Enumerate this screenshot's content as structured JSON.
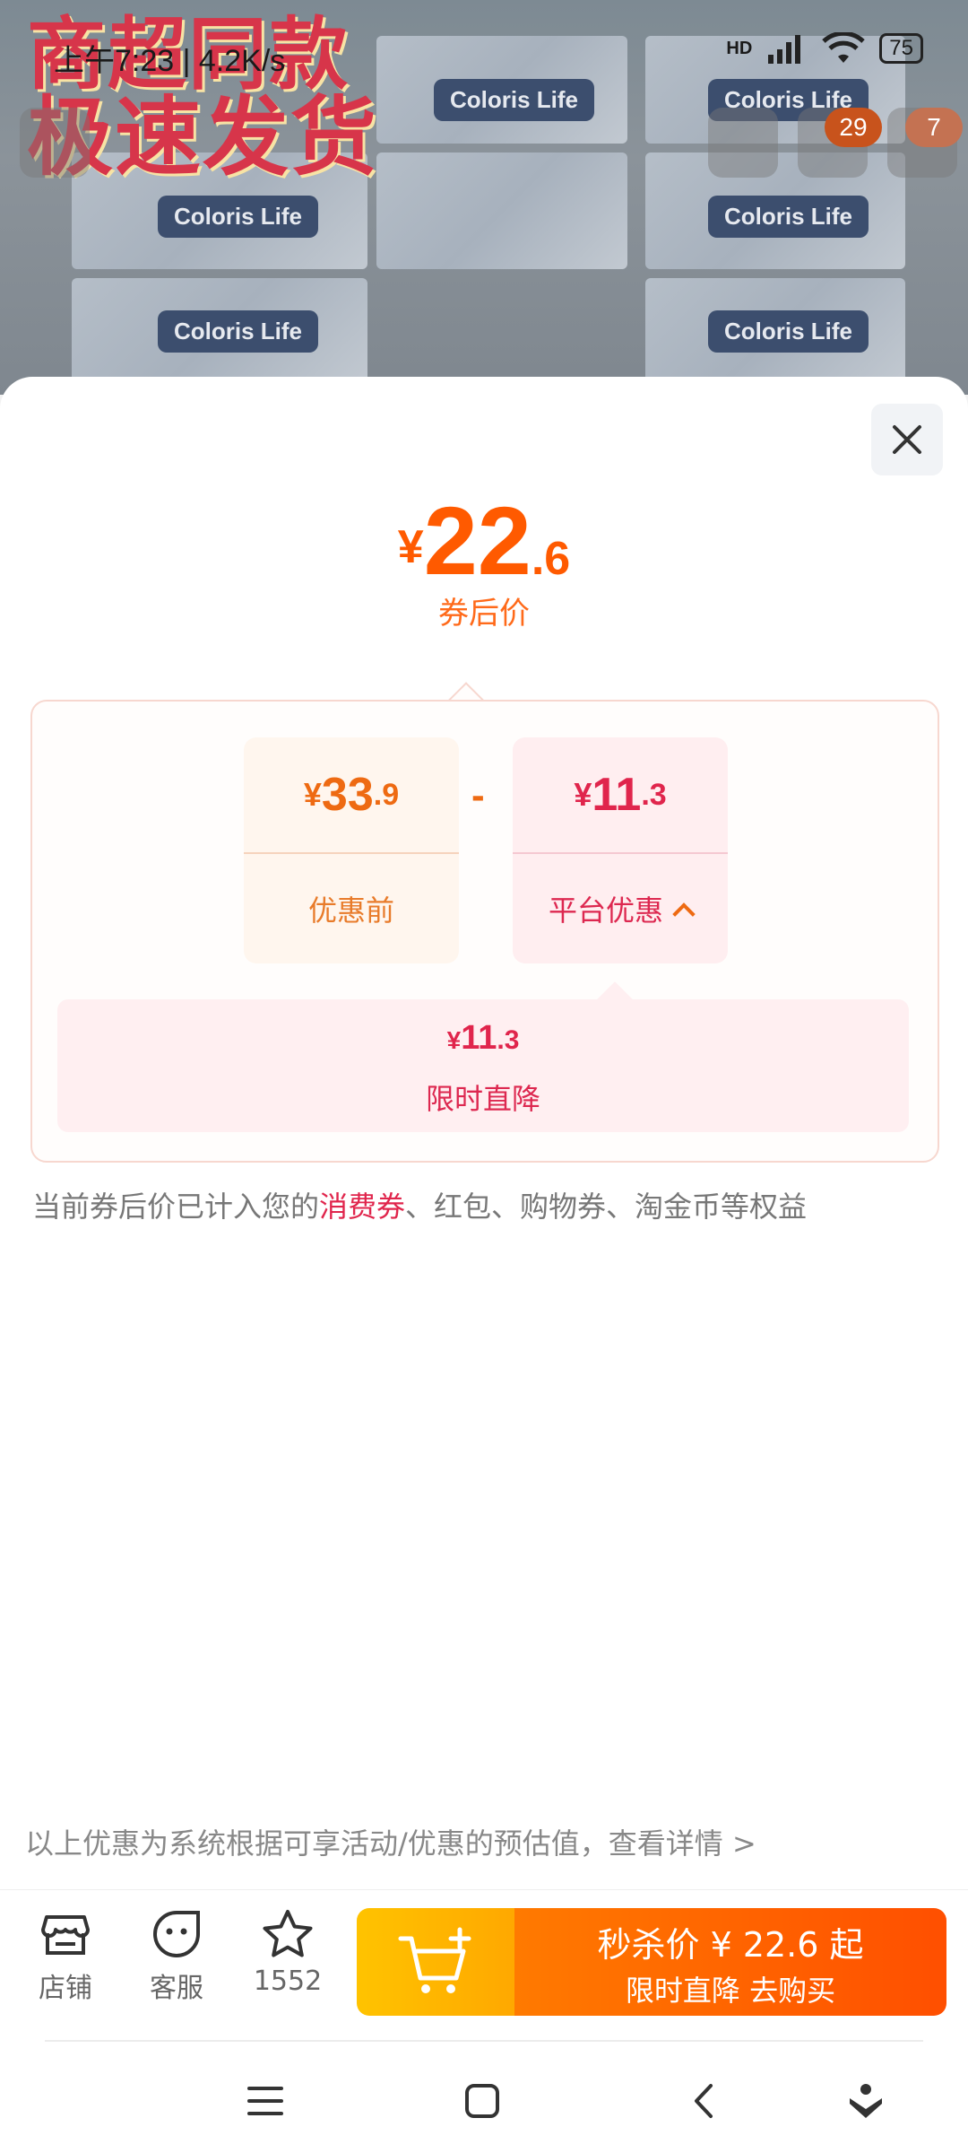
{
  "status_bar": {
    "time_speed": "上午7:23 | 4.2K/s",
    "network_tag": "HD",
    "battery": "75"
  },
  "background": {
    "promo_line1": "商超同款",
    "promo_line2": "极速发货",
    "brand": "Coloris Life",
    "badges": [
      "29",
      "7"
    ]
  },
  "sheet": {
    "price": {
      "yen": "¥",
      "int": "22",
      "dec": ".6"
    },
    "price_label": "券后价",
    "before": {
      "yen": "¥",
      "int": "33",
      "dec": ".9",
      "label": "优惠前"
    },
    "minus": "-",
    "platform": {
      "yen": "¥",
      "int": "11",
      "dec": ".3",
      "label": "平台优惠"
    },
    "sub_item": {
      "yen": "¥",
      "int": "11",
      "dec": ".3",
      "label": "限时直降"
    },
    "note_prefix": "当前券后价已计入您的",
    "note_highlight": "消费券",
    "note_suffix": "、红包、购物券、淘金币等权益",
    "estimate_text": "以上优惠为系统根据可享活动/优惠的预估值，查看详情 >"
  },
  "bottom_bar": {
    "store_label": "店铺",
    "service_label": "客服",
    "favorite_count": "1552",
    "buy_line1": "秒杀价 ¥ 22.6 起",
    "buy_line2": "限时直降  去购买"
  },
  "colors": {
    "accent_orange": "#ff5a00",
    "accent_red": "#e0254c",
    "badge_orange": "#ff5a1f"
  }
}
